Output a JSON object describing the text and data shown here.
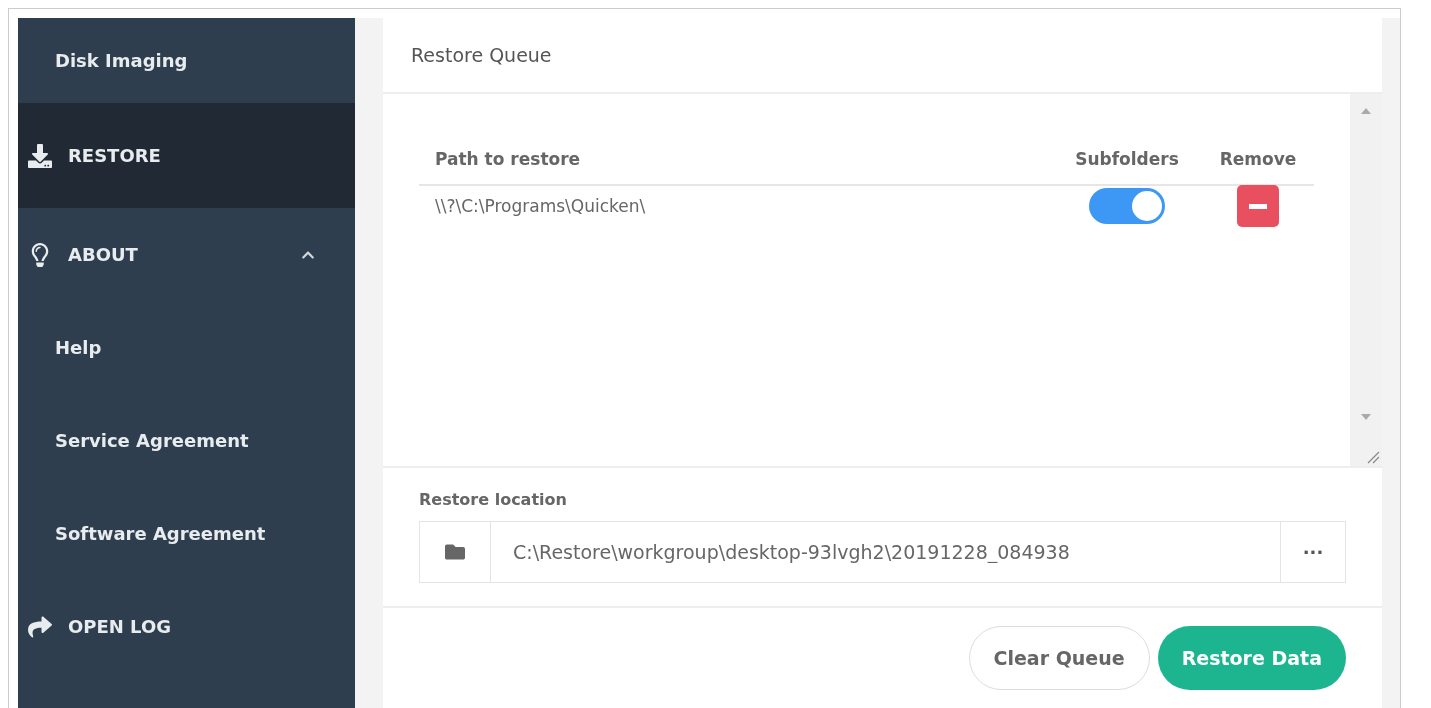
{
  "sidebar": {
    "items": [
      {
        "label": "Disk Imaging",
        "kind": "sub",
        "selected": false
      },
      {
        "label": "RESTORE",
        "kind": "section",
        "selected": true
      },
      {
        "label": "ABOUT",
        "kind": "section",
        "selected": false,
        "expanded": true,
        "children": [
          {
            "label": "Help",
            "selected": false
          },
          {
            "label": "Service Agreement",
            "selected": false
          },
          {
            "label": "Software Agreement",
            "selected": false
          }
        ]
      },
      {
        "label": "OPEN LOG",
        "kind": "section",
        "selected": false
      }
    ]
  },
  "queue": {
    "title": "Restore Queue",
    "columns": [
      "Path to restore",
      "Subfolders",
      "Remove"
    ],
    "rows": [
      {
        "path": "\\\\?\\C:\\Programs\\Quicken\\",
        "subfolders": true
      }
    ]
  },
  "location": {
    "label": "Restore location",
    "value": "C:\\Restore\\workgroup\\desktop-93lvgh2\\20191228_084938",
    "browse": "···"
  },
  "buttons": [
    {
      "label": "Clear Queue",
      "kind": "secondary"
    },
    {
      "label": "Restore Data",
      "kind": "primary"
    }
  ]
}
